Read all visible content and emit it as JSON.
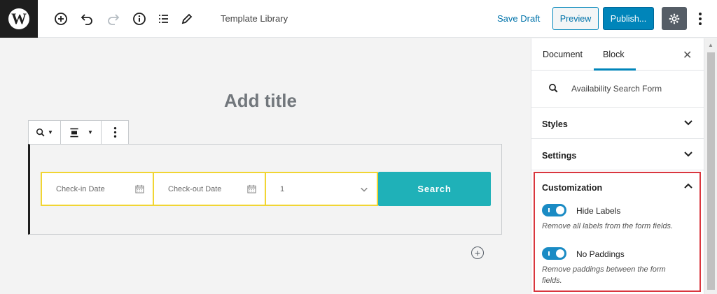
{
  "topbar": {
    "logo_letter": "W",
    "title": "Template Library",
    "save_draft": "Save Draft",
    "preview": "Preview",
    "publish": "Publish..."
  },
  "editor": {
    "title_placeholder": "Add title",
    "form": {
      "checkin_placeholder": "Check-in Date",
      "checkout_placeholder": "Check-out Date",
      "guests_value": "1",
      "search_label": "Search"
    }
  },
  "sidebar": {
    "tabs": [
      "Document",
      "Block"
    ],
    "active_tab": "Block",
    "block_name": "Availability Search Form",
    "panels": [
      "Styles",
      "Settings"
    ],
    "customization": {
      "title": "Customization",
      "toggles": [
        {
          "label": "Hide Labels",
          "help": "Remove all labels from the form fields.",
          "on": true
        },
        {
          "label": "No Paddings",
          "help": "Remove paddings between the form fields.",
          "on": true
        }
      ]
    }
  },
  "colors": {
    "accent": "#0085ba",
    "search_button": "#1fb1b8",
    "field_border": "#f1d533",
    "highlight_border": "#d9363e",
    "toggle_on": "#1a8bc4"
  },
  "icons": [
    "wordpress-logo-icon",
    "add-block-icon",
    "undo-icon",
    "redo-icon",
    "info-icon",
    "list-view-icon",
    "edit-icon",
    "gear-icon",
    "more-vertical-icon",
    "search-icon",
    "align-icon",
    "calendar-icon",
    "chevron-down-icon",
    "chevron-up-icon",
    "close-icon"
  ]
}
